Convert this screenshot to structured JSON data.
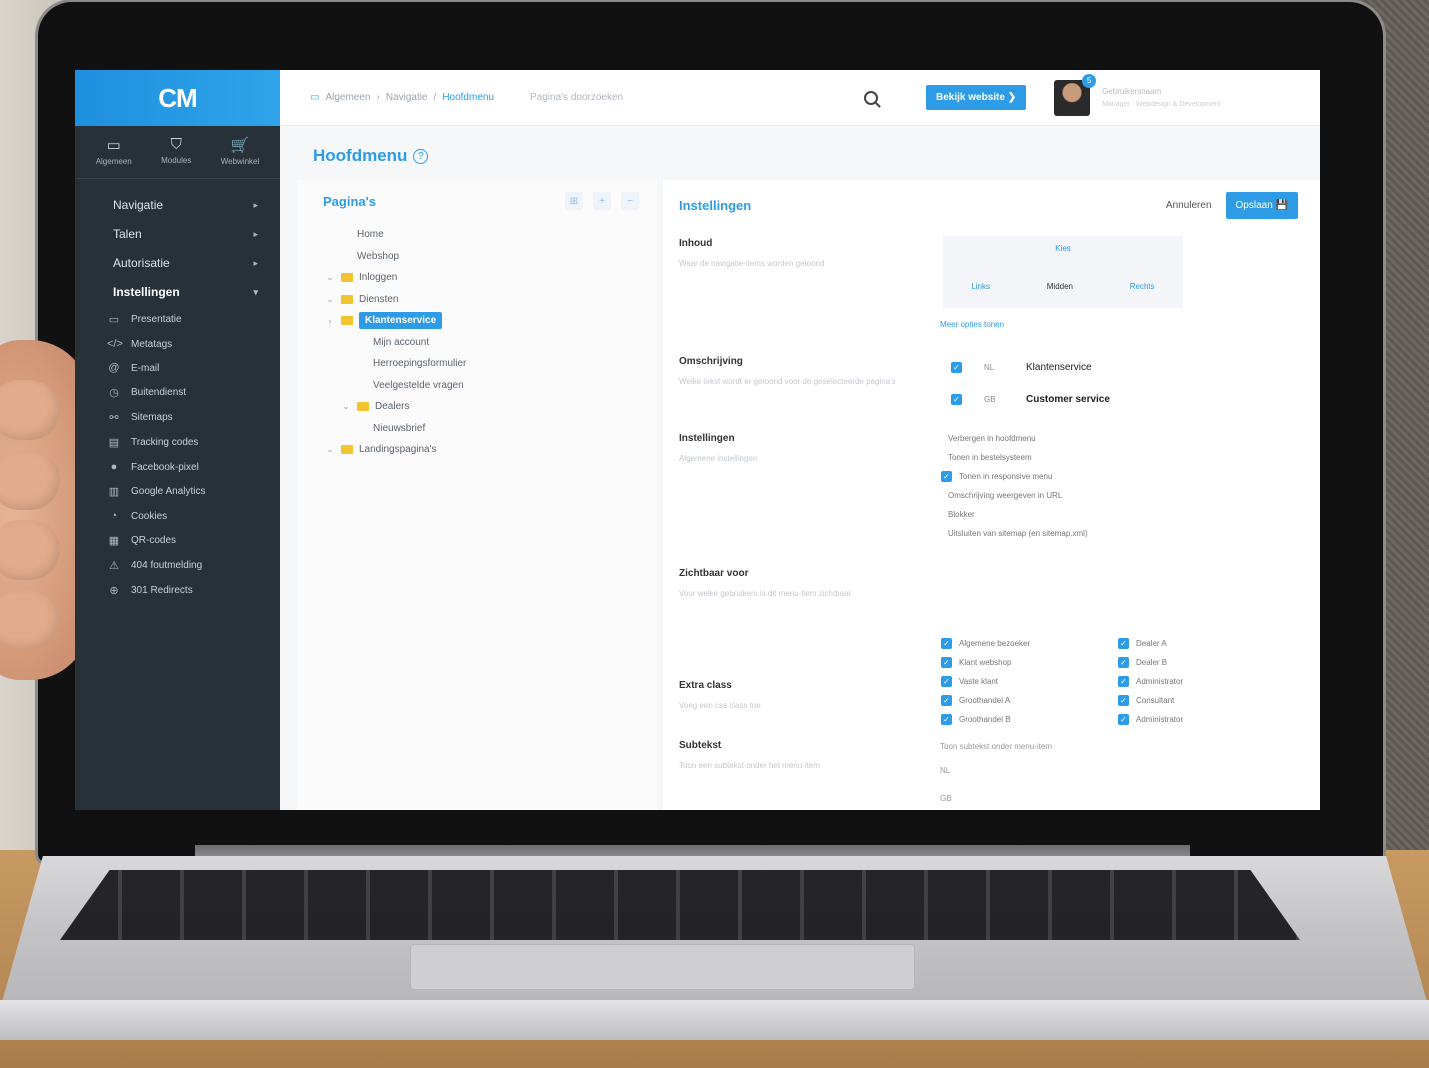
{
  "app": {
    "logo": "CM",
    "top_icons": [
      {
        "icon": "calendar-icon",
        "glyph": "▭",
        "label": "Algemeen"
      },
      {
        "icon": "shield-icon",
        "glyph": "⛉",
        "label": "Modules"
      },
      {
        "icon": "cart-icon",
        "glyph": "🛒",
        "label": "Webwinkel"
      }
    ]
  },
  "sidebar": {
    "nav": [
      {
        "label": "Navigatie",
        "caret": "▸"
      },
      {
        "label": "Talen",
        "caret": "▸"
      },
      {
        "label": "Autorisatie",
        "caret": "▸"
      },
      {
        "label": "Instellingen",
        "caret": "▾"
      }
    ],
    "sub": [
      {
        "icon": "monitor-icon",
        "glyph": "▭",
        "label": "Presentatie"
      },
      {
        "icon": "code-icon",
        "glyph": "</>",
        "label": "Metatags"
      },
      {
        "icon": "at-icon",
        "glyph": "@",
        "label": "E-mail"
      },
      {
        "icon": "clock-icon",
        "glyph": "◷",
        "label": "Buitendienst"
      },
      {
        "icon": "sitemap-icon",
        "glyph": "⚯",
        "label": "Sitemaps"
      },
      {
        "icon": "chart-icon",
        "glyph": "▤",
        "label": "Tracking codes"
      },
      {
        "icon": "facebook-icon",
        "glyph": "●",
        "label": "Facebook-pixel"
      },
      {
        "icon": "bar-chart-icon",
        "glyph": "▥",
        "label": "Google Analytics"
      },
      {
        "icon": "cookie-icon",
        "glyph": "◔",
        "label": "Cookies"
      },
      {
        "icon": "qr-icon",
        "glyph": "▦",
        "label": "QR-codes"
      },
      {
        "icon": "warning-icon",
        "glyph": "⚠",
        "label": "404 foutmelding"
      },
      {
        "icon": "redirect-icon",
        "glyph": "⊕",
        "label": "301 Redirects"
      }
    ]
  },
  "topbar": {
    "breadcrumb": [
      "Algemeen",
      "Navigatie",
      "Hoofdmenu"
    ],
    "separators": [
      "›",
      "/"
    ],
    "search_placeholder": "Pagina's doorzoeken",
    "visit_button": "Bekijk website ❯",
    "badge": "5",
    "user_name": "Gebruikersnaam",
    "user_role": "Manager · Webdesign & Development"
  },
  "page": {
    "title": "Hoofdmenu",
    "help": "?"
  },
  "pages_panel": {
    "title": "Pagina's",
    "tools": [
      "⊞",
      "+",
      "−"
    ],
    "tree": [
      {
        "label": "Home",
        "depth": 1,
        "toggle": "",
        "folder": false
      },
      {
        "label": "Webshop",
        "depth": 1,
        "toggle": "",
        "folder": false
      },
      {
        "label": "Inloggen",
        "depth": 0,
        "toggle": "⌄",
        "folder": true
      },
      {
        "label": "Diensten",
        "depth": 0,
        "toggle": "⌄",
        "folder": true
      },
      {
        "label": "Klantenservice",
        "depth": 0,
        "toggle": "›",
        "folder": true,
        "selected": true
      },
      {
        "label": "Mijn account",
        "depth": 2,
        "toggle": "",
        "folder": false
      },
      {
        "label": "Herroepingsformulier",
        "depth": 2,
        "toggle": "",
        "folder": false
      },
      {
        "label": "Veelgestelde vragen",
        "depth": 2,
        "toggle": "",
        "folder": false
      },
      {
        "label": "Dealers",
        "depth": 1,
        "toggle": "⌄",
        "folder": true
      },
      {
        "label": "Nieuwsbrief",
        "depth": 2,
        "toggle": "",
        "folder": false
      },
      {
        "label": "Landingspagina's",
        "depth": 0,
        "toggle": "⌄",
        "folder": true
      }
    ]
  },
  "settings_panel": {
    "title": "Instellingen",
    "cancel": "Annuleren",
    "save": "Opslaan",
    "save_icon": "💾",
    "fields": {
      "inhoud": {
        "label": "Inhoud",
        "hint": "Waar de navigatie-items worden getoond"
      },
      "omschrijving": {
        "label": "Omschrijving",
        "hint": "Welke tekst wordt er getoond voor de geselecteerde pagina's"
      },
      "instellingen": {
        "label": "Instellingen",
        "hint": "Algemene instellingen"
      },
      "zichtbaar": {
        "label": "Zichtbaar voor",
        "hint": "Voor welke gebruikers is dit menu-item zichtbaar"
      },
      "extra_class": {
        "label": "Extra class",
        "hint": "Voeg een css class toe"
      },
      "subtekst": {
        "label": "Subtekst",
        "hint": "Toon een subtekst onder het menu-item"
      }
    },
    "alignment": {
      "top": "Kies",
      "left": "Links",
      "middle": "Midden",
      "right": "Rechts"
    },
    "more_link": "Meer opties tonen",
    "languages": [
      {
        "code": "NL",
        "label": "Klantenservice"
      },
      {
        "code": "GB",
        "label": "Customer service"
      }
    ],
    "options": [
      {
        "label": "Verbergen in hoofdmenu",
        "checked": false
      },
      {
        "label": "Tonen in bestelsysteem",
        "checked": false
      },
      {
        "label": "Tonen in responsive menu",
        "checked": true
      },
      {
        "label": "Omschrijving weergeven in URL",
        "checked": false
      },
      {
        "label": "Blokker",
        "checked": false
      },
      {
        "label": "Uitsluiten van sitemap (en sitemap.xml)",
        "checked": false
      }
    ],
    "visibility_left": [
      "Algemene bezoeker",
      "Klant webshop",
      "Vaste klant",
      "Groothandel A",
      "Groothandel B"
    ],
    "visibility_right": [
      "Dealer A",
      "Dealer B",
      "Administrator",
      "Consultant",
      "Administrator"
    ],
    "subtext_hint": "Toon subtekst onder menu-item",
    "subtext_langs": [
      "NL",
      "GB"
    ]
  },
  "colors": {
    "accent": "#2d9be6",
    "sidebar": "#283038"
  }
}
